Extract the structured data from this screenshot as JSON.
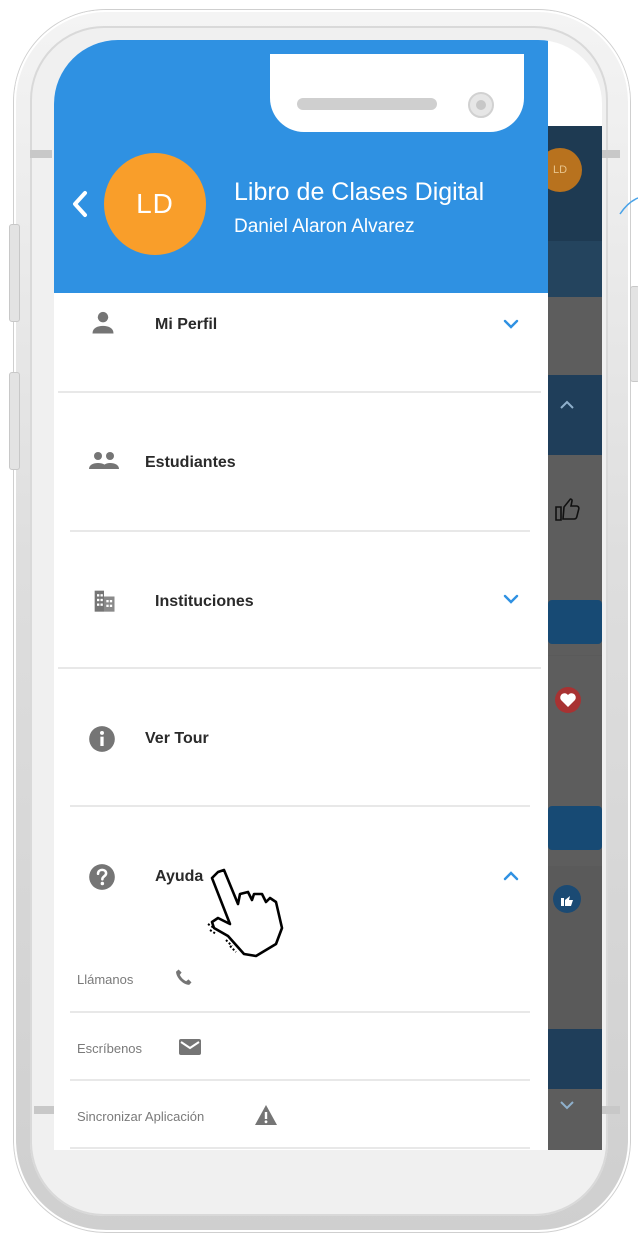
{
  "header": {
    "avatar_initials": "LD",
    "app_title": "Libro de Clases Digital",
    "user_name": "Daniel Alaron Alvarez",
    "back_icon": "chevron-left-icon"
  },
  "menu": {
    "items": [
      {
        "label": "Mi Perfil",
        "icon": "person-icon",
        "expand": "chevron-down-icon"
      },
      {
        "label": "Estudiantes",
        "icon": "people-icon"
      },
      {
        "label": "Instituciones",
        "icon": "building-icon",
        "expand": "chevron-down-icon"
      },
      {
        "label": "Ver Tour",
        "icon": "info-icon"
      },
      {
        "label": "Ayuda",
        "icon": "help-icon",
        "expand": "chevron-up-icon"
      }
    ],
    "help_subitems": [
      {
        "label": "Llámanos",
        "icon": "phone-icon"
      },
      {
        "label": "Escríbenos",
        "icon": "mail-icon"
      },
      {
        "label": "Sincronizar Aplicación",
        "icon": "warning-icon"
      }
    ]
  },
  "background_app": {
    "avatar_initials": "LD"
  },
  "colors": {
    "header_blue": "#2f91e2",
    "avatar_orange": "#f99e2a",
    "icon_gray": "#757575",
    "chevron_blue": "#2f91e2",
    "label_dark": "#2a2a2a"
  }
}
